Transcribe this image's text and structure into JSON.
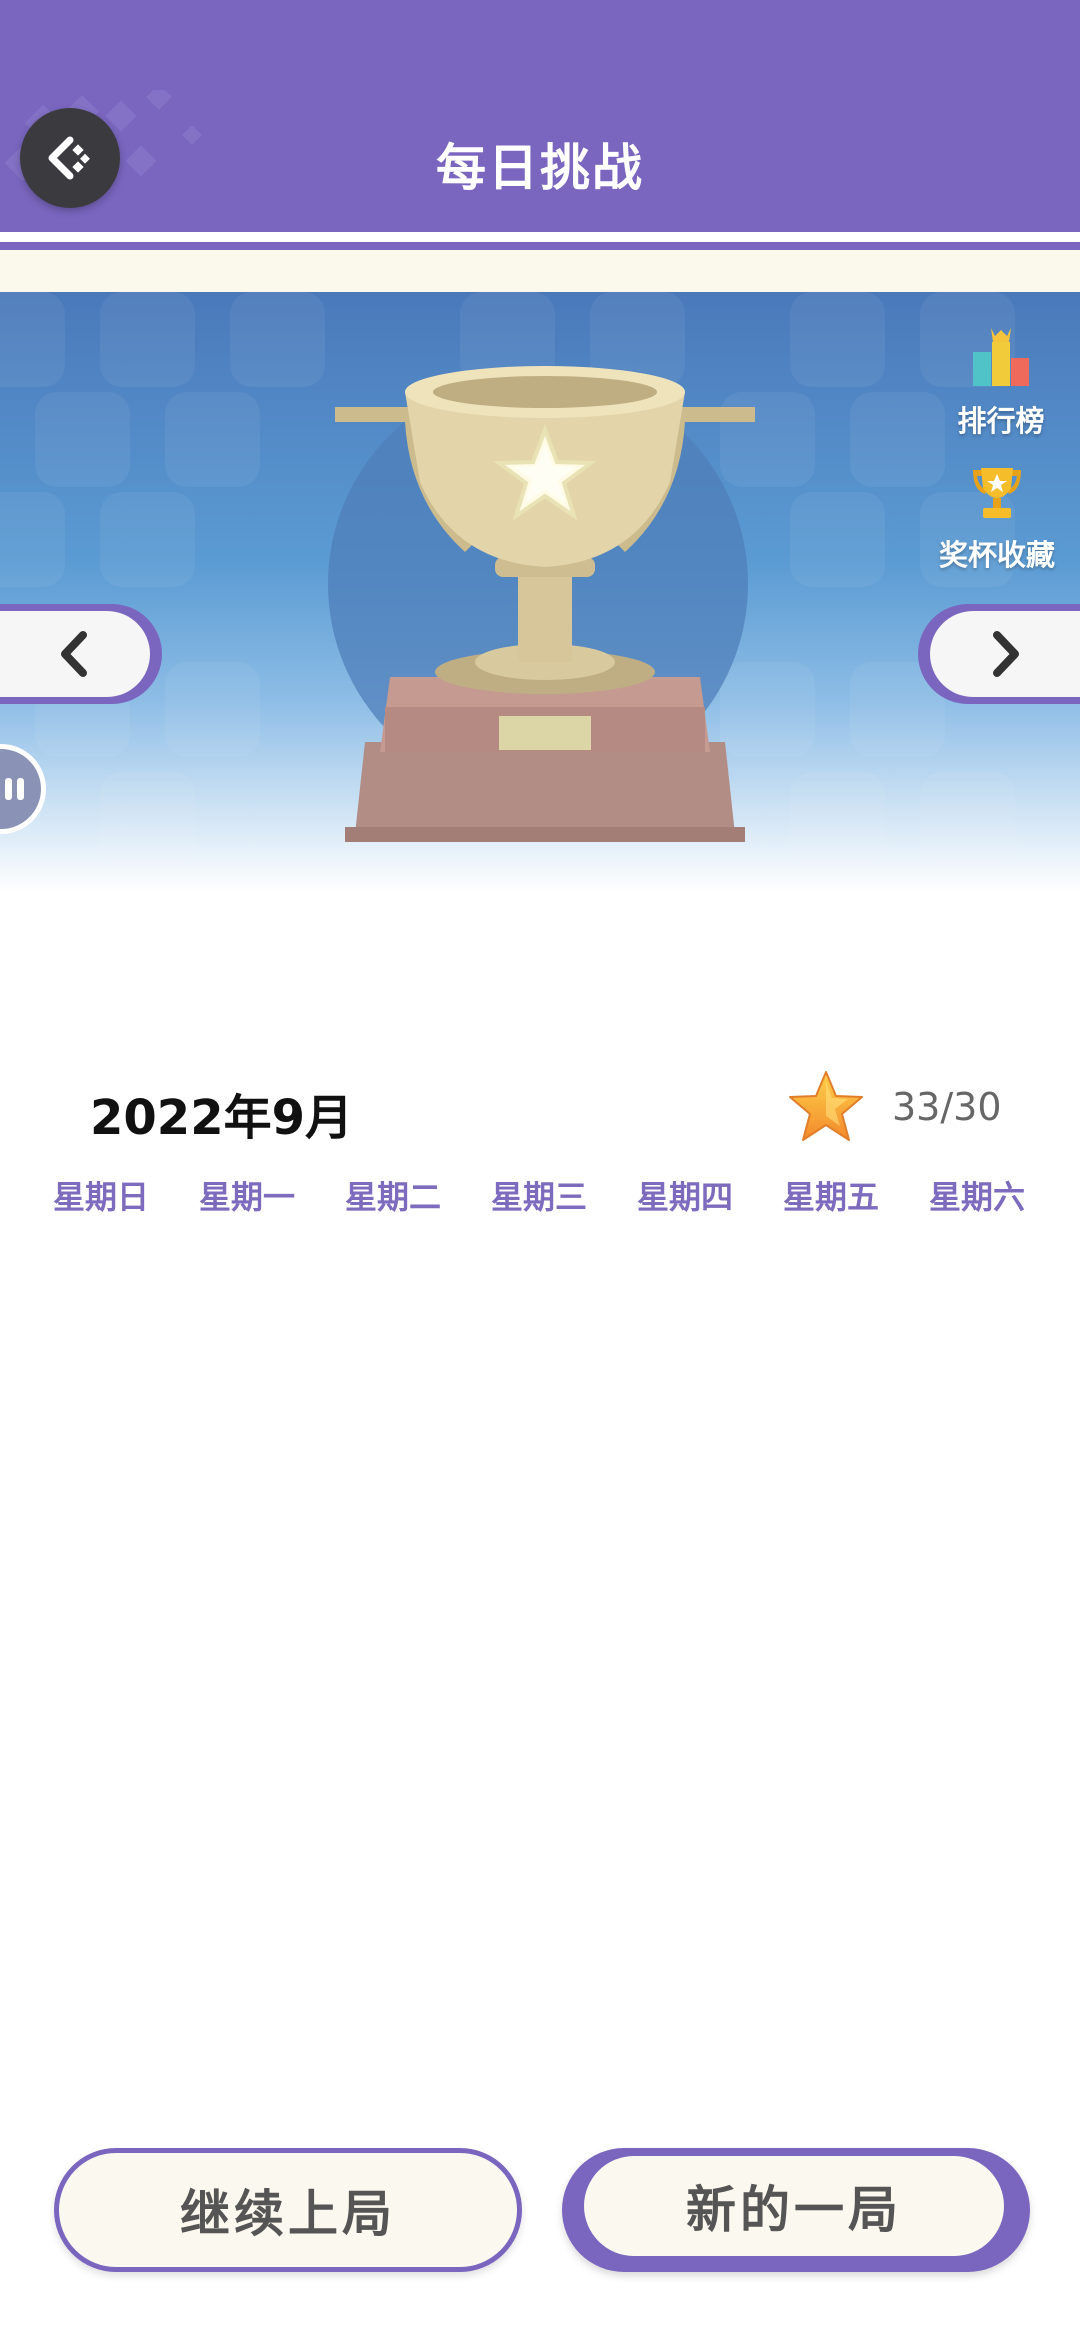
{
  "header": {
    "title": "每日挑战",
    "back_icon": "back-arrow-icon",
    "color": "#7a66bf"
  },
  "banner": {
    "leaderboard_label": "排行榜",
    "trophy_collection_label": "奖杯收藏",
    "prev_icon": "chevron-left-icon",
    "next_icon": "chevron-right-icon"
  },
  "calendar": {
    "month_label": "2022年9月",
    "stars_text": "33/30",
    "weekdays": [
      "星期日",
      "星期一",
      "星期二",
      "星期三",
      "星期四",
      "星期五",
      "星期六"
    ]
  },
  "actions": {
    "continue_label": "继续上局",
    "new_game_label": "新的一局"
  }
}
